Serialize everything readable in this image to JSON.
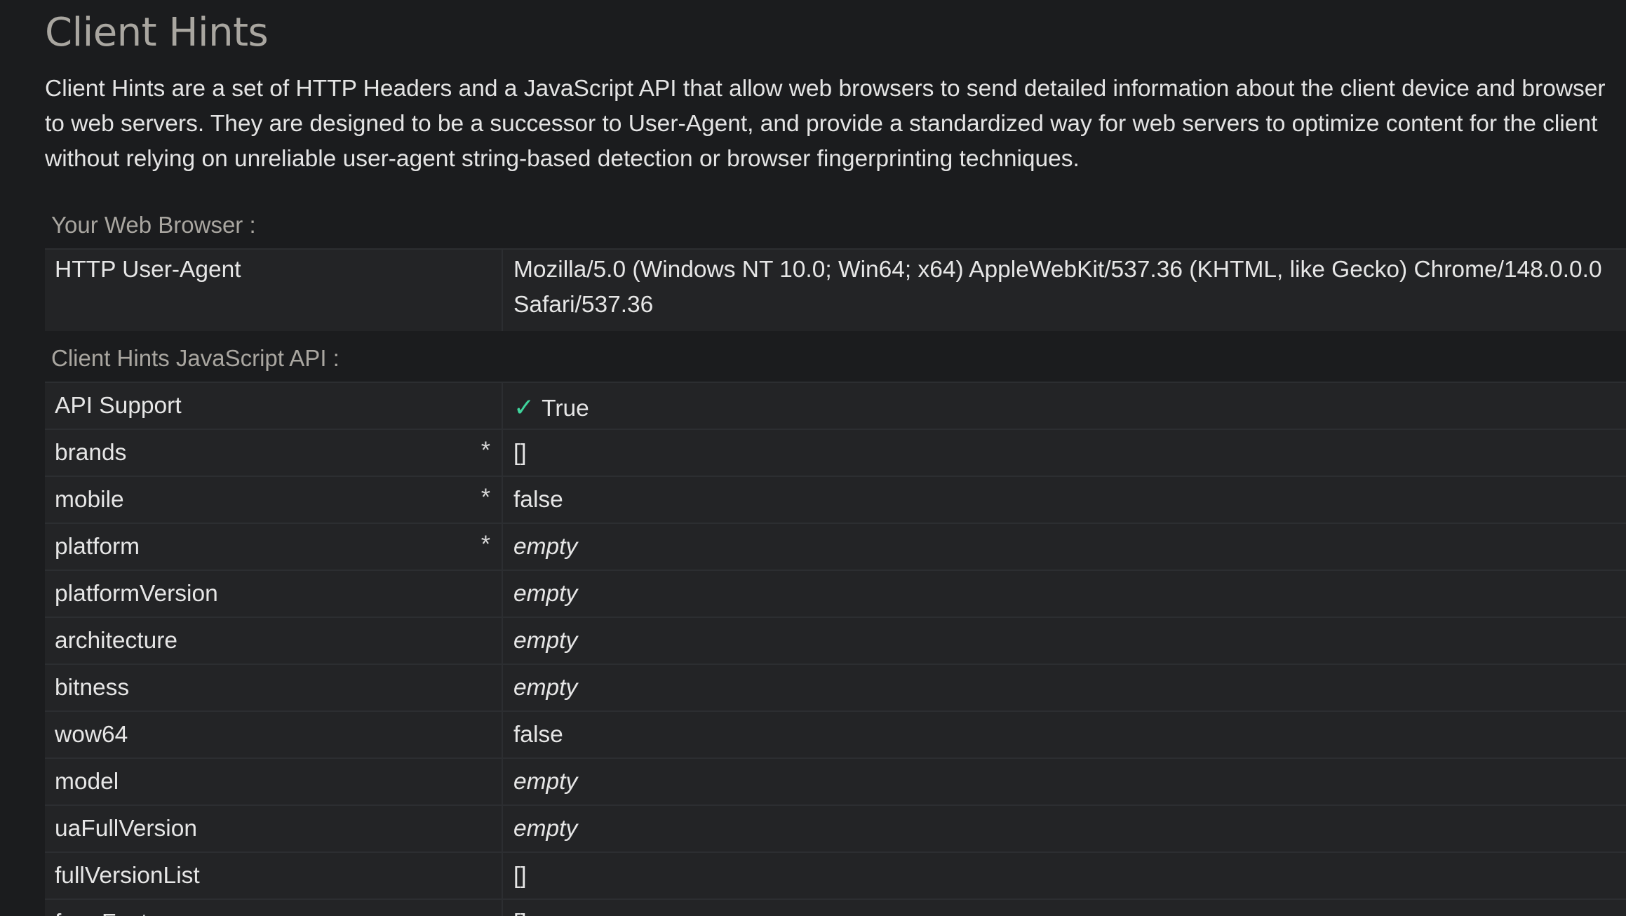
{
  "page": {
    "title": "Client Hints",
    "intro_lines": [
      "Client Hints are a set of HTTP Headers and a JavaScript API that allow web browsers to send detailed information about the client device and browser",
      "to web servers. They are designed to be a successor to User-Agent, and provide a standardized way for web servers to optimize content for the client",
      "without relying on unreliable user-agent string-based detection or browser fingerprinting techniques."
    ]
  },
  "browser_section": {
    "caption": "Your Web Browser :",
    "rows": [
      {
        "key": "HTTP User-Agent",
        "value_line1": "Mozilla/5.0 (Windows NT 10.0; Win64; x64) AppleWebKit/537.36 (KHTML, like Gecko) Chrome/148.0.0.0",
        "value_line2": "Safari/537.36"
      }
    ]
  },
  "js_api_section": {
    "caption": "Client Hints JavaScript API :",
    "api_support": {
      "key": "API Support",
      "check_icon": "check-icon",
      "value": "True",
      "check_color": "#3fd49c"
    },
    "rows": [
      {
        "key": "brands",
        "star": "*",
        "value": "[]",
        "empty": false
      },
      {
        "key": "mobile",
        "star": "*",
        "value": "false",
        "empty": false
      },
      {
        "key": "platform",
        "star": "*",
        "value": "empty",
        "empty": true
      },
      {
        "key": "platformVersion",
        "star": "",
        "value": "empty",
        "empty": true
      },
      {
        "key": "architecture",
        "star": "",
        "value": "empty",
        "empty": true
      },
      {
        "key": "bitness",
        "star": "",
        "value": "empty",
        "empty": true
      },
      {
        "key": "wow64",
        "star": "",
        "value": "false",
        "empty": false
      },
      {
        "key": "model",
        "star": "",
        "value": "empty",
        "empty": true
      },
      {
        "key": "uaFullVersion",
        "star": "",
        "value": "empty",
        "empty": true
      },
      {
        "key": "fullVersionList",
        "star": "",
        "value": "[]",
        "empty": false
      },
      {
        "key": "formFactors",
        "star": "",
        "value": "[]",
        "empty": false
      }
    ]
  },
  "colors": {
    "background": "#1b1c1e",
    "row_background": "#232426",
    "heading": "#a9a6a0",
    "text": "#e6e6e6",
    "accent_check": "#3fd49c"
  }
}
